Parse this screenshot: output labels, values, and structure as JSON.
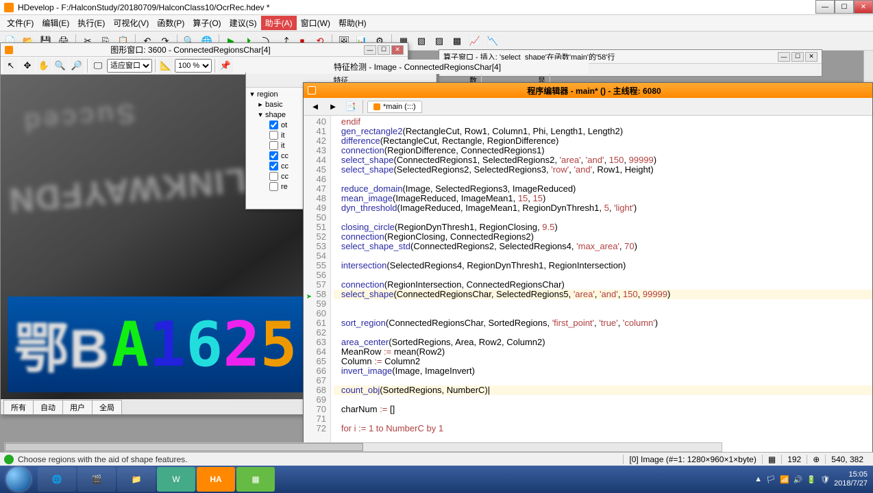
{
  "app": {
    "title": "HDevelop - F:/HalconStudy/20180709/HalconClass10/OcrRec.hdev *"
  },
  "menu": {
    "file": "文件(F)",
    "edit": "编辑(E)",
    "run": "执行(E)",
    "visual": "可视化(V)",
    "func": "函数(P)",
    "op": "算子(O)",
    "advice": "建议(S)",
    "asst": "助手(A)",
    "win": "窗口(W)",
    "help": "帮助(H)"
  },
  "gfx": {
    "title": "图形窗口: 3600 - ConnectedRegionsChar[4]",
    "fit": "适应窗口",
    "zoom": "100 %",
    "tabs": {
      "all": "所有",
      "auto": "自动",
      "user": "用户",
      "global": "全局"
    }
  },
  "feat": {
    "hdr": {
      "feature": "特征",
      "value": "数值",
      "disp": "显示"
    },
    "tree": {
      "region": "region",
      "basic": "basic",
      "shape": "shape",
      "items": [
        "ot",
        "it",
        "it",
        "cc",
        "cc",
        "cc",
        "re"
      ]
    },
    "title_extra": "特征检测 - Image - ConnectedRegionsChar[4]"
  },
  "bgwin": {
    "title": "算子窗口 - 插入: 'select_shape'在函数'main'的'58'行"
  },
  "editor": {
    "title": "程序编辑器 - main* () - 主线程: 6080",
    "tab": "*main (:::)"
  },
  "code": {
    "start": 40,
    "lines": [
      {
        "n": 40,
        "t": "endif",
        "cls": "kw"
      },
      {
        "n": 41,
        "t": "gen_rectangle2(RectangleCut, Row1, Column1, Phi, Length1, Length2)"
      },
      {
        "n": 42,
        "t": "difference(RectangleCut, Rectangle, RegionDifference)"
      },
      {
        "n": 43,
        "t": "connection(RegionDifference, ConnectedRegions1)"
      },
      {
        "n": 44,
        "t": "select_shape(ConnectedRegions1, SelectedRegions2, 'area', 'and', 150, 99999)"
      },
      {
        "n": 45,
        "t": "select_shape(SelectedRegions2, SelectedRegions3, 'row', 'and', Row1, Height)"
      },
      {
        "n": 46,
        "t": ""
      },
      {
        "n": 47,
        "t": "reduce_domain(Image, SelectedRegions3, ImageReduced)"
      },
      {
        "n": 48,
        "t": "mean_image(ImageReduced, ImageMean1, 15, 15)"
      },
      {
        "n": 49,
        "t": "dyn_threshold(ImageReduced, ImageMean1, RegionDynThresh1, 5, 'light')"
      },
      {
        "n": 50,
        "t": ""
      },
      {
        "n": 51,
        "t": "closing_circle(RegionDynThresh1, RegionClosing, 9.5)"
      },
      {
        "n": 52,
        "t": "connection(RegionClosing, ConnectedRegions2)"
      },
      {
        "n": 53,
        "t": "select_shape_std(ConnectedRegions2, SelectedRegions4, 'max_area', 70)"
      },
      {
        "n": 54,
        "t": ""
      },
      {
        "n": 55,
        "t": "intersection(SelectedRegions4, RegionDynThresh1, RegionIntersection)"
      },
      {
        "n": 56,
        "t": ""
      },
      {
        "n": 57,
        "t": "connection(RegionIntersection, ConnectedRegionsChar)"
      },
      {
        "n": 58,
        "t": "select_shape(ConnectedRegionsChar, SelectedRegions5, 'area', 'and', 150, 99999)",
        "marker": true,
        "hl": true
      },
      {
        "n": 59,
        "t": ""
      },
      {
        "n": 60,
        "t": ""
      },
      {
        "n": 61,
        "t": "sort_region(ConnectedRegionsChar, SortedRegions, 'first_point', 'true', 'column')"
      },
      {
        "n": 62,
        "t": ""
      },
      {
        "n": 63,
        "t": "area_center(SortedRegions, Area, Row2, Column2)"
      },
      {
        "n": 64,
        "t": "MeanRow := mean(Row2)",
        "fn": true
      },
      {
        "n": 65,
        "t": "Column := Column2",
        "fn": true
      },
      {
        "n": 66,
        "t": "invert_image(Image, ImageInvert)"
      },
      {
        "n": 67,
        "t": ""
      },
      {
        "n": 68,
        "t": "count_obj(SortedRegions, NumberC)|",
        "hl": true
      },
      {
        "n": 69,
        "t": ""
      },
      {
        "n": 70,
        "t": "charNum := []",
        "fn": true
      },
      {
        "n": 71,
        "t": ""
      },
      {
        "n": 72,
        "t": "for i := 1 to NumberC by 1",
        "kw": true
      }
    ]
  },
  "plate": {
    "cn": "鄂B",
    "chars": [
      {
        "c": "A",
        "color": "#1e1"
      },
      {
        "c": "1",
        "color": "#22d"
      },
      {
        "c": "6",
        "color": "#2dd"
      },
      {
        "c": "2",
        "color": "#e2e"
      },
      {
        "c": "5",
        "color": "#e90"
      }
    ],
    "bg1": "Succed",
    "bg2": "LINKWAYFDN"
  },
  "status": {
    "msg": "Choose regions with the aid of shape features.",
    "img": "[0] Image (#=1: 1280×960×1×byte)",
    "val": "192",
    "coords": "540, 382"
  },
  "tray": {
    "time": "15:05",
    "date": "2018/7/27"
  }
}
